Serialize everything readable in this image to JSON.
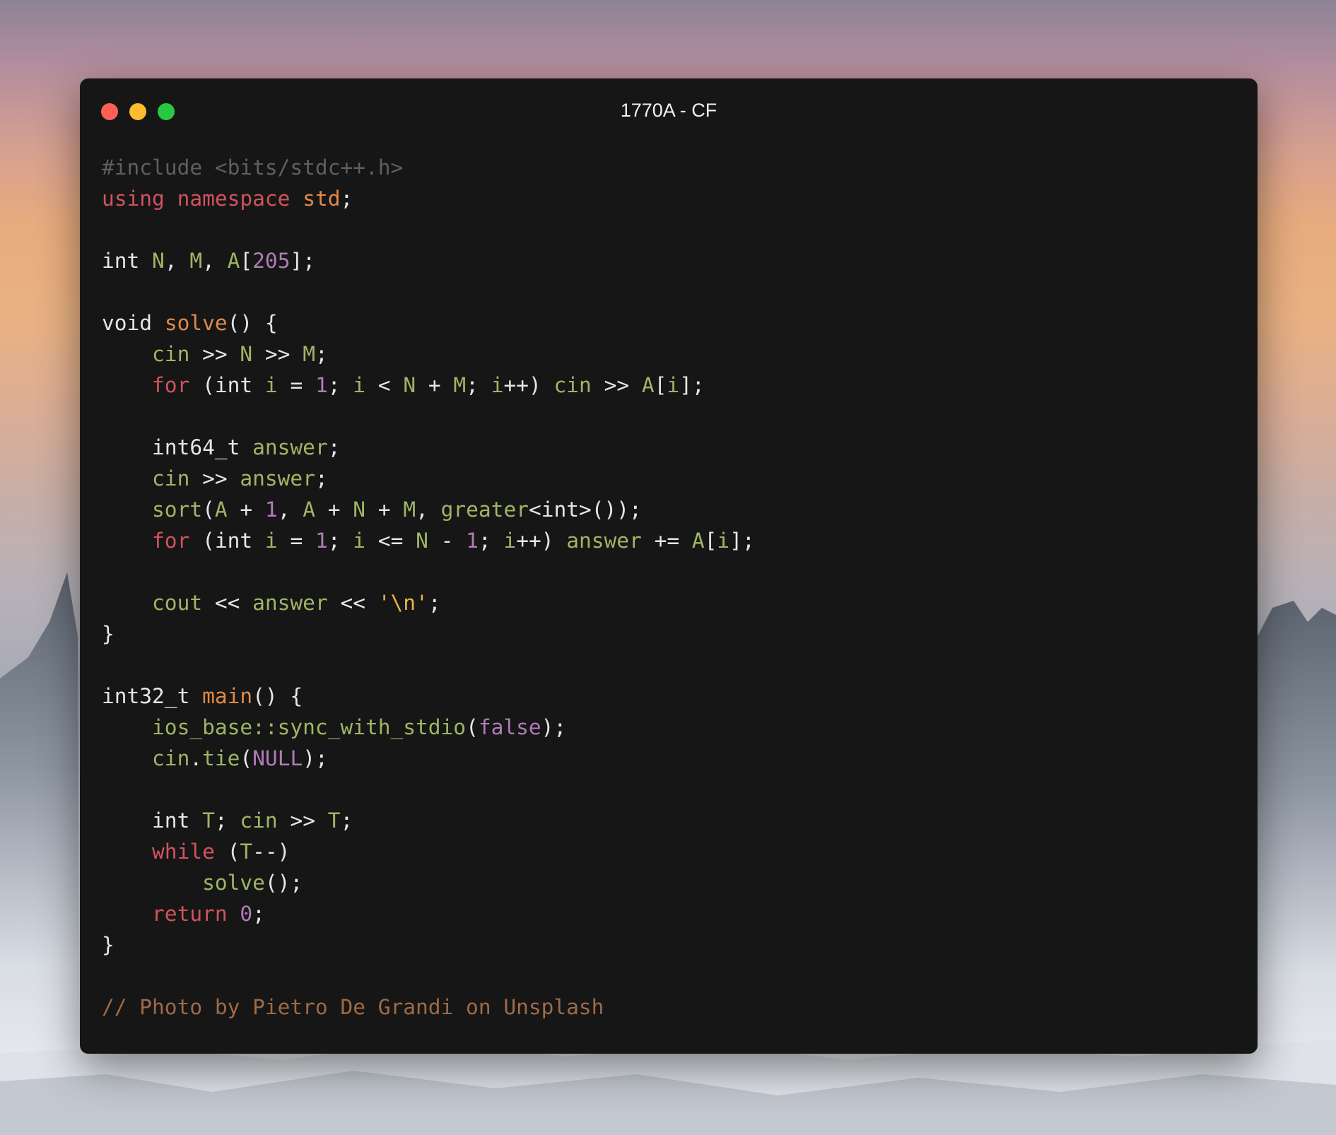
{
  "window": {
    "title": "1770A - CF"
  },
  "code_lines": [
    [
      [
        "pre",
        "#include <bits/stdc++.h>"
      ]
    ],
    [
      [
        "kw",
        "using"
      ],
      [
        "pl",
        " "
      ],
      [
        "kw",
        "namespace"
      ],
      [
        "pl",
        " "
      ],
      [
        "ns",
        "std"
      ],
      [
        "pl",
        ";"
      ]
    ],
    [],
    [
      [
        "pl",
        "int "
      ],
      [
        "var",
        "N"
      ],
      [
        "pl",
        ", "
      ],
      [
        "var",
        "M"
      ],
      [
        "pl",
        ", "
      ],
      [
        "var",
        "A"
      ],
      [
        "pl",
        "["
      ],
      [
        "num",
        "205"
      ],
      [
        "pl",
        "];"
      ]
    ],
    [],
    [
      [
        "pl",
        "void "
      ],
      [
        "fn",
        "solve"
      ],
      [
        "pl",
        "() {"
      ]
    ],
    [
      [
        "pl",
        "    "
      ],
      [
        "var",
        "cin"
      ],
      [
        "pl",
        " >> "
      ],
      [
        "var",
        "N"
      ],
      [
        "pl",
        " >> "
      ],
      [
        "var",
        "M"
      ],
      [
        "pl",
        ";"
      ]
    ],
    [
      [
        "pl",
        "    "
      ],
      [
        "kw",
        "for"
      ],
      [
        "pl",
        " (int "
      ],
      [
        "var",
        "i"
      ],
      [
        "pl",
        " = "
      ],
      [
        "num",
        "1"
      ],
      [
        "pl",
        "; "
      ],
      [
        "var",
        "i"
      ],
      [
        "pl",
        " < "
      ],
      [
        "var",
        "N"
      ],
      [
        "pl",
        " + "
      ],
      [
        "var",
        "M"
      ],
      [
        "pl",
        "; "
      ],
      [
        "var",
        "i"
      ],
      [
        "pl",
        "++) "
      ],
      [
        "var",
        "cin"
      ],
      [
        "pl",
        " >> "
      ],
      [
        "var",
        "A"
      ],
      [
        "pl",
        "["
      ],
      [
        "var",
        "i"
      ],
      [
        "pl",
        "];"
      ]
    ],
    [],
    [
      [
        "pl",
        "    int64_t "
      ],
      [
        "var",
        "answer"
      ],
      [
        "pl",
        ";"
      ]
    ],
    [
      [
        "pl",
        "    "
      ],
      [
        "var",
        "cin"
      ],
      [
        "pl",
        " >> "
      ],
      [
        "var",
        "answer"
      ],
      [
        "pl",
        ";"
      ]
    ],
    [
      [
        "pl",
        "    "
      ],
      [
        "var",
        "sort"
      ],
      [
        "pl",
        "("
      ],
      [
        "var",
        "A"
      ],
      [
        "pl",
        " + "
      ],
      [
        "num",
        "1"
      ],
      [
        "pl",
        ", "
      ],
      [
        "var",
        "A"
      ],
      [
        "pl",
        " + "
      ],
      [
        "var",
        "N"
      ],
      [
        "pl",
        " + "
      ],
      [
        "var",
        "M"
      ],
      [
        "pl",
        ", "
      ],
      [
        "var",
        "greater"
      ],
      [
        "pl",
        "<int>());"
      ]
    ],
    [
      [
        "pl",
        "    "
      ],
      [
        "kw",
        "for"
      ],
      [
        "pl",
        " (int "
      ],
      [
        "var",
        "i"
      ],
      [
        "pl",
        " = "
      ],
      [
        "num",
        "1"
      ],
      [
        "pl",
        "; "
      ],
      [
        "var",
        "i"
      ],
      [
        "pl",
        " <= "
      ],
      [
        "var",
        "N"
      ],
      [
        "pl",
        " - "
      ],
      [
        "num",
        "1"
      ],
      [
        "pl",
        "; "
      ],
      [
        "var",
        "i"
      ],
      [
        "pl",
        "++) "
      ],
      [
        "var",
        "answer"
      ],
      [
        "pl",
        " += "
      ],
      [
        "var",
        "A"
      ],
      [
        "pl",
        "["
      ],
      [
        "var",
        "i"
      ],
      [
        "pl",
        "];"
      ]
    ],
    [],
    [
      [
        "pl",
        "    "
      ],
      [
        "var",
        "cout"
      ],
      [
        "pl",
        " << "
      ],
      [
        "var",
        "answer"
      ],
      [
        "pl",
        " << "
      ],
      [
        "str",
        "'\\n'"
      ],
      [
        "pl",
        ";"
      ]
    ],
    [
      [
        "pl",
        "}"
      ]
    ],
    [],
    [
      [
        "pl",
        "int32_t "
      ],
      [
        "fn",
        "main"
      ],
      [
        "pl",
        "() {"
      ]
    ],
    [
      [
        "pl",
        "    "
      ],
      [
        "var",
        "ios_base::sync_with_stdio"
      ],
      [
        "pl",
        "("
      ],
      [
        "num",
        "false"
      ],
      [
        "pl",
        ");"
      ]
    ],
    [
      [
        "pl",
        "    "
      ],
      [
        "var",
        "cin"
      ],
      [
        "pl",
        "."
      ],
      [
        "var",
        "tie"
      ],
      [
        "pl",
        "("
      ],
      [
        "num",
        "NULL"
      ],
      [
        "pl",
        ");"
      ]
    ],
    [],
    [
      [
        "pl",
        "    int "
      ],
      [
        "var",
        "T"
      ],
      [
        "pl",
        "; "
      ],
      [
        "var",
        "cin"
      ],
      [
        "pl",
        " >> "
      ],
      [
        "var",
        "T"
      ],
      [
        "pl",
        ";"
      ]
    ],
    [
      [
        "pl",
        "    "
      ],
      [
        "kw",
        "while"
      ],
      [
        "pl",
        " ("
      ],
      [
        "var",
        "T"
      ],
      [
        "pl",
        "--)"
      ]
    ],
    [
      [
        "pl",
        "        "
      ],
      [
        "var",
        "solve"
      ],
      [
        "pl",
        "();"
      ]
    ],
    [
      [
        "pl",
        "    "
      ],
      [
        "kw",
        "return"
      ],
      [
        "pl",
        " "
      ],
      [
        "num",
        "0"
      ],
      [
        "pl",
        ";"
      ]
    ],
    [
      [
        "pl",
        "}"
      ]
    ],
    [],
    [
      [
        "cm",
        "// Photo by Pietro De Grandi on Unsplash"
      ]
    ]
  ],
  "colors": {
    "window_bg": "#161616",
    "close": "#ff5f57",
    "minimize": "#febc2e",
    "maximize": "#28c840"
  }
}
